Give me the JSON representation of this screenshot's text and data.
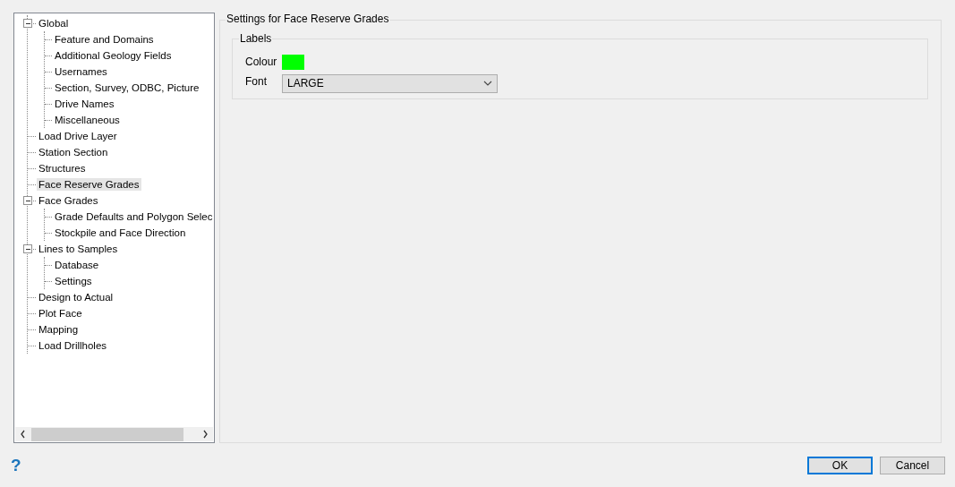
{
  "tree": [
    {
      "label": "Global",
      "expanded": true,
      "selected": false,
      "children": [
        {
          "label": "Feature and Domains",
          "selected": false
        },
        {
          "label": "Additional Geology Fields",
          "selected": false
        },
        {
          "label": "Usernames",
          "selected": false
        },
        {
          "label": "Section, Survey, ODBC, Picture",
          "selected": false
        },
        {
          "label": "Drive Names",
          "selected": false
        },
        {
          "label": "Miscellaneous",
          "selected": false
        }
      ]
    },
    {
      "label": "Load Drive Layer",
      "selected": false
    },
    {
      "label": "Station Section",
      "selected": false
    },
    {
      "label": "Structures",
      "selected": false
    },
    {
      "label": "Face Reserve Grades",
      "selected": true
    },
    {
      "label": "Face Grades",
      "expanded": true,
      "selected": false,
      "children": [
        {
          "label": "Grade Defaults and Polygon Selec",
          "selected": false
        },
        {
          "label": "Stockpile and Face Direction",
          "selected": false
        }
      ]
    },
    {
      "label": "Lines to Samples",
      "expanded": true,
      "selected": false,
      "children": [
        {
          "label": "Database",
          "selected": false
        },
        {
          "label": "Settings",
          "selected": false
        }
      ]
    },
    {
      "label": "Design to Actual",
      "selected": false
    },
    {
      "label": "Plot Face",
      "selected": false
    },
    {
      "label": "Mapping",
      "selected": false
    },
    {
      "label": "Load Drillholes",
      "selected": false
    }
  ],
  "settings": {
    "title": "Settings for Face Reserve Grades",
    "group": {
      "title": "Labels",
      "colour_label": "Colour",
      "color": "#00ff00",
      "font_label": "Font",
      "font_value": "LARGE"
    }
  },
  "help": "?",
  "buttons": [
    {
      "label": "OK",
      "default": true
    },
    {
      "label": "Cancel",
      "default": false
    }
  ]
}
